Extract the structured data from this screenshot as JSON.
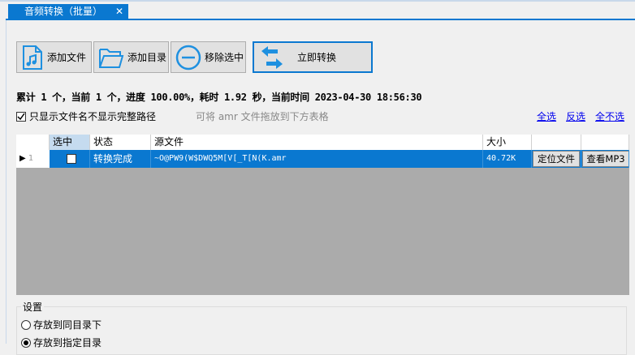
{
  "tab": {
    "title": "音频转换（批量）",
    "close": "✕"
  },
  "toolbar": {
    "add_file": "添加文件",
    "add_dir": "添加目录",
    "remove": "移除选中",
    "convert": "立即转换"
  },
  "status": "累计 1 个，当前 1 个，进度 100.00%，耗时 1.92 秒，当前时间 2023-04-30 18:56:30",
  "options": {
    "filename_only": "只显示文件名不显示完整路径",
    "hint": "可将 amr 文件拖放到下方表格",
    "select_all": "全选",
    "invert": "反选",
    "select_none": "全不选"
  },
  "grid": {
    "headers": [
      "选中",
      "状态",
      "源文件",
      "大小"
    ],
    "rows": [
      {
        "index": "1",
        "status": "转换完成",
        "file": "~O@PW9(W$DWQ5M[V[_T[N(K.amr",
        "size": "40.72K",
        "locate": "定位文件",
        "view": "查看MP3"
      }
    ]
  },
  "settings": {
    "label": "设置",
    "same_dir": "存放到同目录下",
    "custom_dir": "存放到指定目录"
  },
  "colors": {
    "accent": "#0a78d0"
  }
}
